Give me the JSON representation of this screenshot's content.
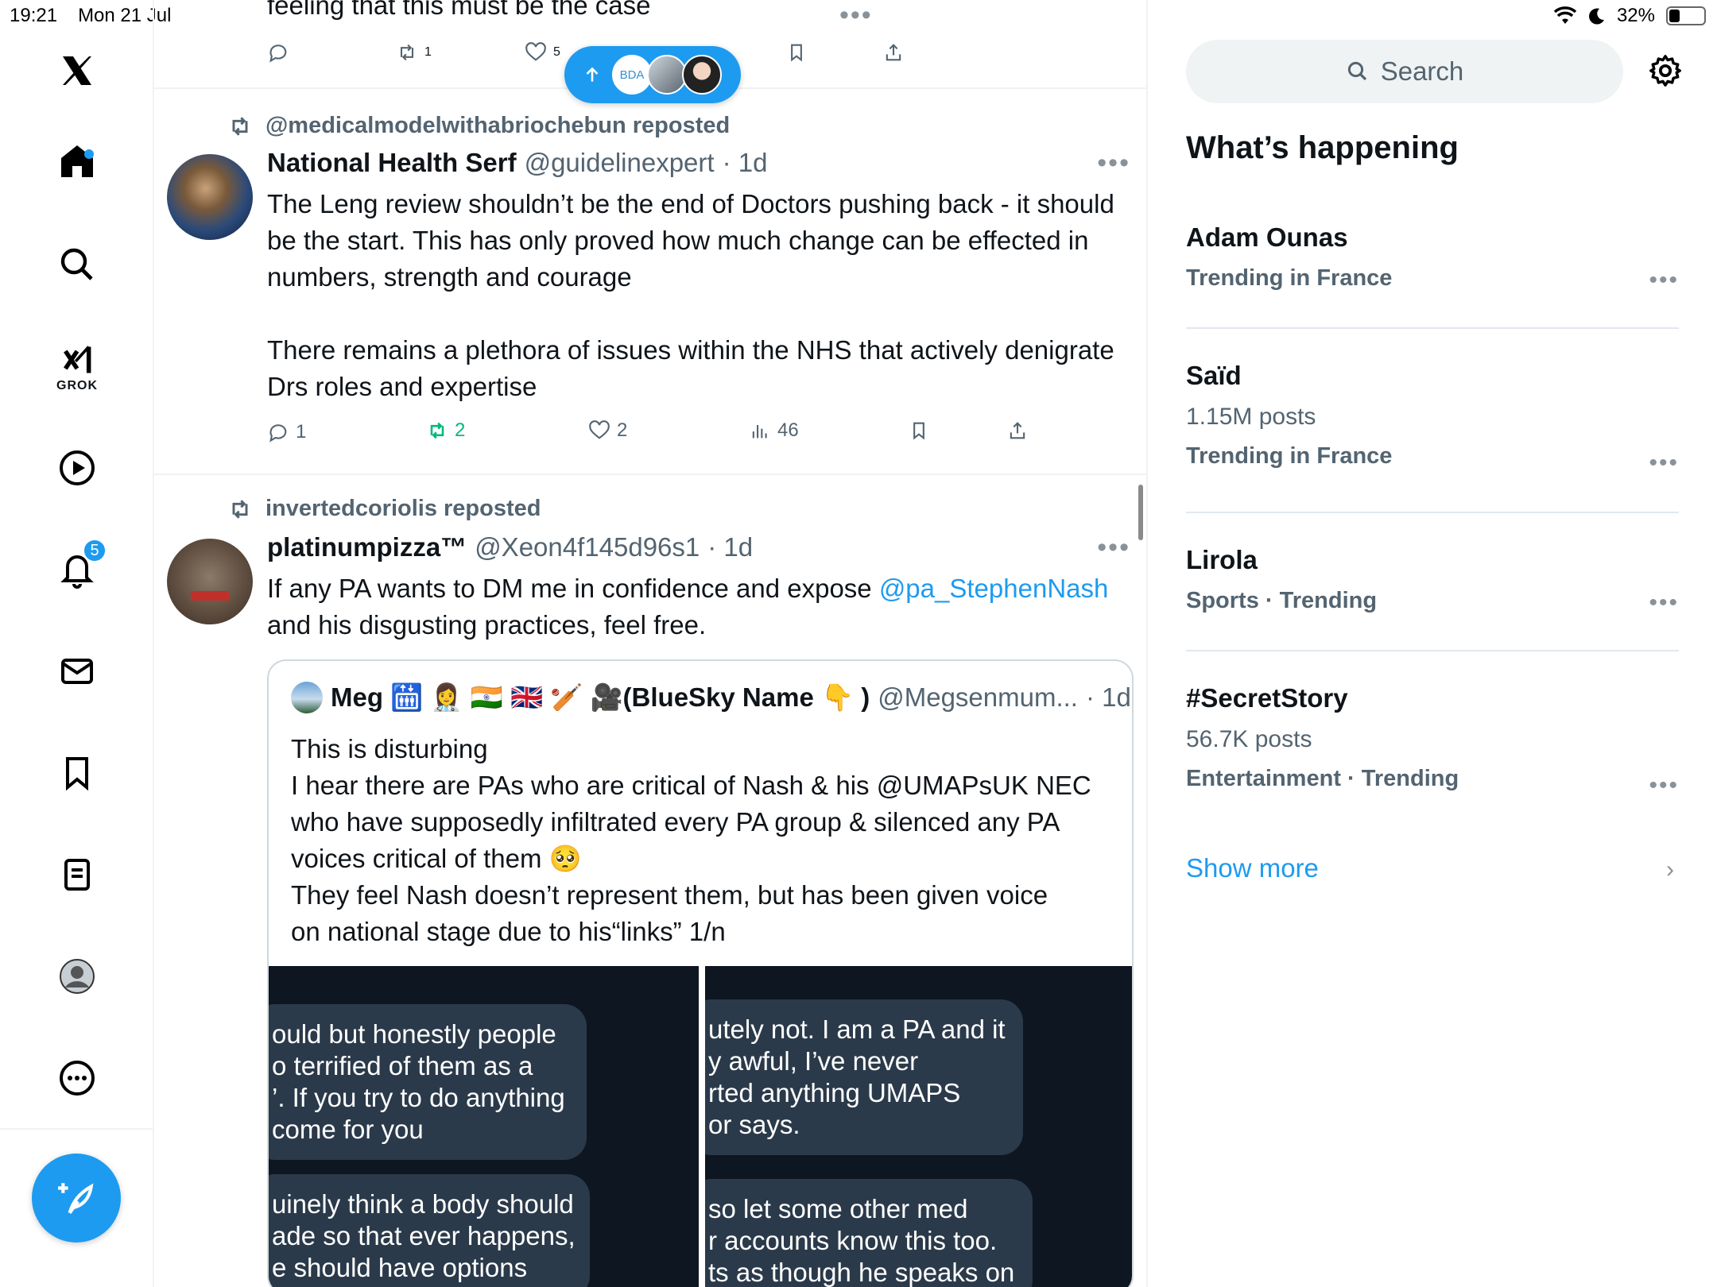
{
  "status_bar": {
    "time": "19:21",
    "date": "Mon 21 Jul",
    "battery": "32%",
    "battery_level": 0.32
  },
  "nav": {
    "grok_label": "GROK",
    "notifications_badge": "5",
    "items": [
      "home-icon",
      "search-icon",
      "grok-icon",
      "video-icon",
      "bell-icon",
      "mail-icon",
      "bookmark-icon",
      "list-icon",
      "profile-icon",
      "more-icon"
    ]
  },
  "top_post": {
    "text": "feeling that this must be the case",
    "retweets": "1",
    "likes": "5"
  },
  "pill": {
    "avatar1_text": "BDA"
  },
  "tweet1": {
    "repost_label": "@medicalmodelwithabriochebun reposted",
    "name": "National Health Serf",
    "handle": "@guidelinexpert",
    "time": "· 1d",
    "para1": "The Leng review shouldn’t be the end of Doctors pushing back - it should be the start. This has only proved how much change can be effected in numbers, strength and courage",
    "para2": "There remains a plethora of issues within the NHS that actively denigrate Drs roles and expertise",
    "replies": "1",
    "retweets": "2",
    "likes": "2",
    "views": "46"
  },
  "tweet2": {
    "repost_label": "invertedcoriolis reposted",
    "name": "platinumpizza™",
    "handle": "@Xeon4f145d96s1",
    "time": "· 1d",
    "text_before": "If any PA wants to DM me in confidence and expose ",
    "mention": "@pa_StephenNash",
    "text_after": " and his disgusting practices, feel free.",
    "quote": {
      "name": "Meg 🛗 👩‍⚕️ 🇮🇳 🇬🇧 🏏 🎥(BlueSky Name 👇 )",
      "handle": "@Megsenmum...",
      "time": "· 1d",
      "lines": [
        "This is disturbing",
        "I hear there are PAs who are critical of Nash & his @UMAPsUK  NEC",
        "who have supposedly infiltrated every PA group & silenced any PA",
        "voices critical of them 🥺",
        "They feel Nash doesn’t represent them, but has been given voice",
        "on national stage due to his“links” 1/n"
      ],
      "image1_bubbles": [
        [
          "ould but honestly people",
          "o terrified of them as a",
          "’. If you try to do anything",
          "come for you"
        ],
        [
          "uinely think a body should",
          "ade so that ever happens,",
          "e should have options"
        ]
      ],
      "image2_bubbles": [
        [
          "utely not. I am a PA and it",
          "y awful, I’ve never",
          "rted anything UMAPS",
          "or says."
        ],
        [
          "so let some other med",
          "r accounts know this too.",
          "ts as though he speaks on"
        ]
      ]
    }
  },
  "sidebar": {
    "search_placeholder": "Search",
    "heading": "What’s happening",
    "trends": [
      {
        "title": "Adam Ounas",
        "posts": "",
        "meta": "Trending in France"
      },
      {
        "title": "Saïd",
        "posts": "1.15M posts",
        "meta": "Trending in France"
      },
      {
        "title": "Lirola",
        "posts": "",
        "meta": "Sports · Trending"
      },
      {
        "title": "#SecretStory",
        "posts": "56.7K posts",
        "meta": "Entertainment · Trending"
      }
    ],
    "show_more": "Show more"
  },
  "colors": {
    "accent": "#1d9bf0",
    "retweet_active": "#00ba7c",
    "muted": "#536471"
  }
}
